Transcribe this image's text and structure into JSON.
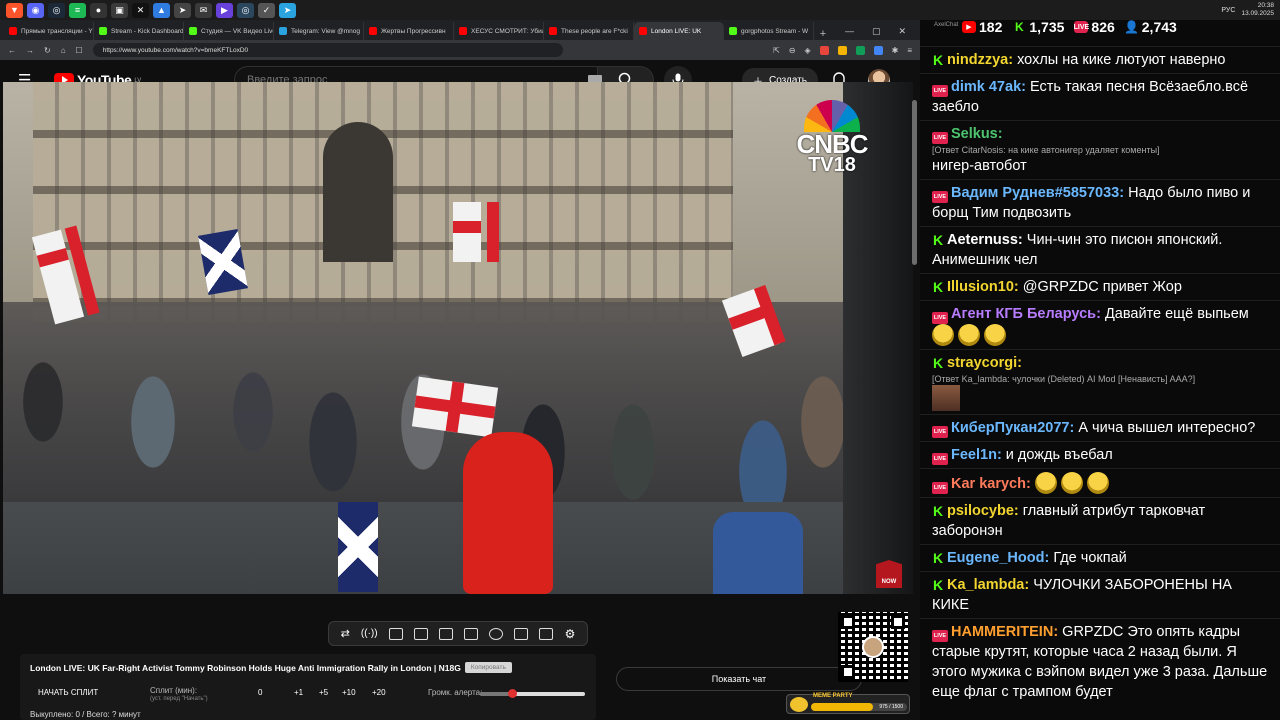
{
  "taskbar": {
    "icons": [
      {
        "name": "brave-icon",
        "color": "#fb542b",
        "glyph": "▼"
      },
      {
        "name": "discord-icon",
        "color": "#5865f2",
        "glyph": "◉"
      },
      {
        "name": "steam-icon",
        "color": "#1b2838",
        "glyph": "◎"
      },
      {
        "name": "spotify-icon",
        "color": "#1db954",
        "glyph": "≡"
      },
      {
        "name": "github-icon",
        "color": "#333333",
        "glyph": "●"
      },
      {
        "name": "window-icon",
        "color": "#3a3a3a",
        "glyph": "▣"
      },
      {
        "name": "capcut-icon",
        "color": "#111111",
        "glyph": "✕"
      },
      {
        "name": "app-blue-icon",
        "color": "#2f7be0",
        "glyph": "▲"
      },
      {
        "name": "app-arrow-icon",
        "color": "#444444",
        "glyph": "➤"
      },
      {
        "name": "app-mail-icon",
        "color": "#3a3a3a",
        "glyph": "✉"
      },
      {
        "name": "app-purple-icon",
        "color": "#6741d9",
        "glyph": "▶"
      },
      {
        "name": "app-steam2-icon",
        "color": "#2a475e",
        "glyph": "◎"
      },
      {
        "name": "app-check-icon",
        "color": "#555555",
        "glyph": "✓"
      },
      {
        "name": "telegram-icon",
        "color": "#2aa3df",
        "glyph": "➤"
      }
    ],
    "lang": "РУС",
    "time": "20:38",
    "date": "13.09.2025"
  },
  "browser": {
    "tabs": [
      {
        "label": "Прямые трансляции - Y",
        "color": "#ff0000",
        "active": false
      },
      {
        "label": "Stream - Kick Dashboard",
        "color": "#53fc18",
        "active": false
      },
      {
        "label": "Студия — VK Видео Live",
        "color": "#53fc18",
        "active": false
      },
      {
        "label": "Telegram: View @mnog",
        "color": "#2aa3df",
        "active": false
      },
      {
        "label": "Жертвы Прогрессивн",
        "color": "#ff0000",
        "active": false
      },
      {
        "label": "ХЕСУС СМОТРИТ: Убил",
        "color": "#ff0000",
        "active": false
      },
      {
        "label": "These people are F*cki",
        "color": "#ff0000",
        "active": false
      },
      {
        "label": "London LIVE: UK",
        "color": "#ff0000",
        "active": true
      },
      {
        "label": "gorgphotos Stream - W",
        "color": "#53fc18",
        "active": false
      }
    ],
    "url": "https://www.youtube.com/watch?v=bmeKFTLoxD0"
  },
  "youtube": {
    "logo_text": "YouTube",
    "region": "LV",
    "search_placeholder": "Введите запрос",
    "create_label": "Создать"
  },
  "video": {
    "channel_logo": "CNBC",
    "channel_sub": "TV18",
    "now_label": "NOW"
  },
  "info": {
    "title": "London LIVE: UK Far-Right Activist Tommy Robinson Holds Huge Anti Immigration Rally in London | N18G",
    "chip": "Копировать",
    "split_button": "НАЧАТЬ СПЛИТ",
    "split_label": "Сплит (мин):",
    "split_sub": "(уст. перед \"Начать\")",
    "split_values": [
      "0",
      "+1",
      "+5",
      "+10",
      "+20"
    ],
    "alert_label": "Громк. алерта:",
    "alert_volume": 0.3,
    "bought": "Выкуплено: 0 / Всего: ? минут"
  },
  "show_chat_label": "Показать чат",
  "meme_party": {
    "title": "MEME PARTY",
    "value": "975 / 1500",
    "progress": 0.65
  },
  "chat": {
    "app_title": "AxelChat",
    "stats": [
      {
        "platform": "youtube",
        "value": "182",
        "color": "#ff0000"
      },
      {
        "platform": "kick",
        "value": "1,735",
        "color": "#53fc18"
      },
      {
        "platform": "vklive",
        "value": "826",
        "color": "#e0234e"
      },
      {
        "platform": "total",
        "value": "2,743",
        "color": "#2f8cff"
      }
    ],
    "messages": [
      {
        "platform": "kick",
        "user": "nindzzya",
        "color": "#f2d52f",
        "text": "хохлы на кике лютуют наверно"
      },
      {
        "platform": "live",
        "user": "dimk 47ak",
        "color": "#6bb8ff",
        "text": "Есть такая песня Всёзаебло.всё заебло"
      },
      {
        "platform": "live",
        "user": "Selkus",
        "color": "#4ec36f",
        "reply": "[Ответ CitarNosis: на кике автонигер удаляет коменты]",
        "text": "нигер-автобот"
      },
      {
        "platform": "live",
        "user": "Вадим Руднев#5857033",
        "color": "#6bb8ff",
        "text": "Надо было пиво и борщ Тим подвозить"
      },
      {
        "platform": "kick",
        "user": "Aeternuss",
        "color": "#ffffff",
        "text": "Чин-чин это писюн японский. Анимешник чел"
      },
      {
        "platform": "kick",
        "user": "Illusion10",
        "color": "#f2d52f",
        "text": "@GRPZDC привет Жор"
      },
      {
        "platform": "live",
        "user": "Агент КГБ Беларусь",
        "color": "#b77cff",
        "text": "Давайте ещё выпьем",
        "emotes": 3
      },
      {
        "platform": "kick",
        "user": "straycorgi",
        "color": "#f2d52f",
        "reply": "[Ответ Ka_lambda: чулочки (Deleted) AI Mod [Ненависть] AAA?]",
        "image_emote": true,
        "text": ""
      },
      {
        "platform": "live",
        "user": "КиберПукан2077",
        "color": "#6bb8ff",
        "text": "А чича вышел интересно?"
      },
      {
        "platform": "live",
        "user": "Feel1n",
        "color": "#6bb8ff",
        "text": "и дождь въебал"
      },
      {
        "platform": "live",
        "user": "Kar karych",
        "color": "#ff7b5c",
        "text": "",
        "emotes": 3
      },
      {
        "platform": "kick",
        "user": "psilocybe",
        "color": "#f2d52f",
        "text": "главный атрибут тарковчат заборонэн"
      },
      {
        "platform": "kick",
        "user": "Eugene_Hood",
        "color": "#6bb8ff",
        "text": "Где чокпай"
      },
      {
        "platform": "kick",
        "user": "Ka_lambda",
        "color": "#f2d52f",
        "text": "ЧУЛОЧКИ ЗАБОРОНЕНЫ НА КИКЕ"
      },
      {
        "platform": "live",
        "user": "HAMMERITEIN",
        "color": "#ff9f2f",
        "text": "GRPZDC Это опять кадры старые крутят, которые часа 2 назад были. Я этого мужика с вэйпом видел уже 3 раза. Дальше еще флаг с трампом будет"
      }
    ]
  }
}
